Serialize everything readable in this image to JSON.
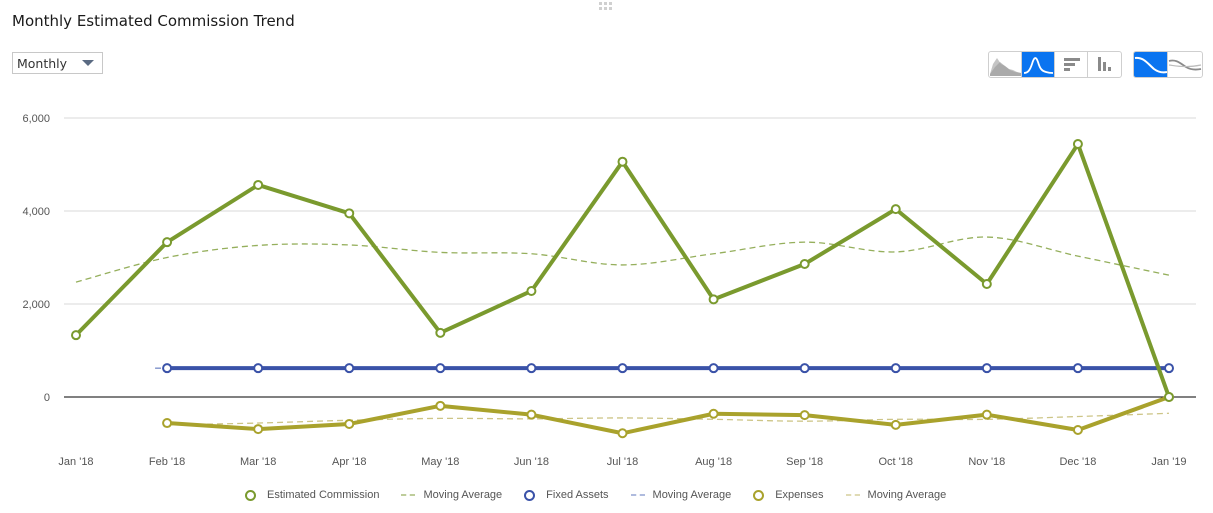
{
  "header": {
    "title": "Monthly Estimated Commission Trend",
    "period_select": {
      "value": "Monthly"
    }
  },
  "toolbar": {
    "chart_type_buttons": [
      {
        "name": "area-chart",
        "active": false
      },
      {
        "name": "line-chart",
        "active": true
      },
      {
        "name": "horizontal-bar-chart",
        "active": false
      },
      {
        "name": "vertical-bar-chart",
        "active": false
      }
    ],
    "curve_buttons": [
      {
        "name": "smooth-curve",
        "active": true
      },
      {
        "name": "trend-compare",
        "active": false
      }
    ]
  },
  "colors": {
    "commission": "#7a9a2e",
    "commission_ma": "#8aa64a",
    "fixed_assets": "#3a52a8",
    "fixed_assets_ma": "#6f84c4",
    "expenses": "#a9a22c",
    "expenses_ma": "#c8bf7a",
    "grid": "#d9d9d9",
    "zero_line": "#000000",
    "active_button": "#0a74f0"
  },
  "chart_data": {
    "type": "line",
    "title": "Monthly Estimated Commission Trend",
    "xlabel": "",
    "ylabel": "",
    "x": [
      "Jan '18",
      "Feb '18",
      "Mar '18",
      "Apr '18",
      "May '18",
      "Jun '18",
      "Jul '18",
      "Aug '18",
      "Sep '18",
      "Oct '18",
      "Nov '18",
      "Dec '18",
      "Jan '19"
    ],
    "ylim": [
      -1000,
      6000
    ],
    "yticks": [
      0,
      2000,
      4000,
      6000
    ],
    "ytick_labels": [
      "0",
      "2,000",
      "4,000",
      "6,000"
    ],
    "grid": true,
    "legend_position": "bottom",
    "series": [
      {
        "name": "Estimated Commission",
        "style": "solid-markers",
        "color_key": "commission",
        "values": [
          1330,
          3330,
          4560,
          3950,
          1380,
          2280,
          5060,
          2100,
          2860,
          4040,
          2430,
          5440,
          0
        ]
      },
      {
        "name": "Moving Average",
        "of": "Estimated Commission",
        "style": "dashed-smooth",
        "color_key": "commission_ma",
        "values": [
          2470,
          3000,
          3260,
          3270,
          3110,
          3080,
          2840,
          3080,
          3330,
          3120,
          3440,
          3030,
          2620
        ]
      },
      {
        "name": "Fixed Assets",
        "style": "solid-markers",
        "color_key": "fixed_assets",
        "values": [
          null,
          620,
          620,
          620,
          620,
          620,
          620,
          620,
          620,
          620,
          620,
          620,
          620
        ]
      },
      {
        "name": "Moving Average",
        "of": "Fixed Assets",
        "style": "dashed-smooth",
        "color_key": "fixed_assets_ma",
        "values": [
          null,
          620,
          620,
          620,
          620,
          620,
          620,
          620,
          620,
          620,
          620,
          620,
          620
        ]
      },
      {
        "name": "Expenses",
        "style": "solid-markers",
        "color_key": "expenses",
        "values": [
          null,
          -560,
          -690,
          -580,
          -190,
          -380,
          -780,
          -360,
          -390,
          -600,
          -380,
          -710,
          0
        ]
      },
      {
        "name": "Moving Average",
        "of": "Expenses",
        "style": "dashed-smooth",
        "color_key": "expenses_ma",
        "values": [
          null,
          -600,
          -560,
          -500,
          -460,
          -470,
          -450,
          -480,
          -520,
          -480,
          -480,
          -420,
          -350
        ]
      }
    ]
  }
}
